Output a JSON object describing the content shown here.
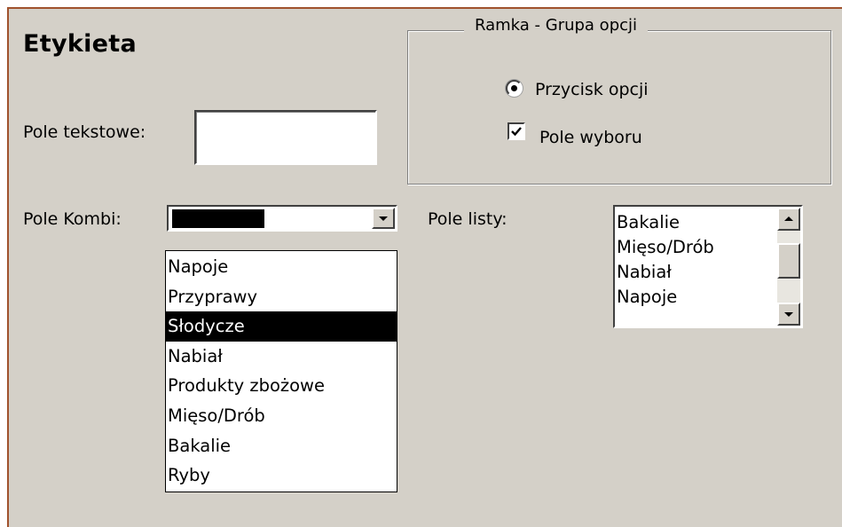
{
  "form": {
    "label": "Etykieta",
    "textbox_label": "Pole tekstowe:",
    "textbox_value": "",
    "frame": {
      "title": "Ramka - Grupa opcji",
      "option_label": "Przycisk opcji",
      "option_selected": true,
      "checkbox_label": "Pole wyboru",
      "checkbox_checked": true
    },
    "combo": {
      "label": "Pole Kombi:",
      "value": "",
      "items": [
        "Napoje",
        "Przyprawy",
        "Słodycze",
        "Nabiał",
        "Produkty zbożowe",
        "Mięso/Drób",
        "Bakalie",
        "Ryby"
      ],
      "highlighted_item": "Słodycze"
    },
    "listbox": {
      "label": "Pole listy:",
      "items": [
        "Bakalie",
        "Mięso/Drób",
        "Nabiał",
        "Napoje"
      ]
    }
  },
  "colors": {
    "form_background": "#d4d0c8",
    "form_border": "#a0522d",
    "selection_background": "#000000",
    "selection_text": "#ffffff"
  }
}
